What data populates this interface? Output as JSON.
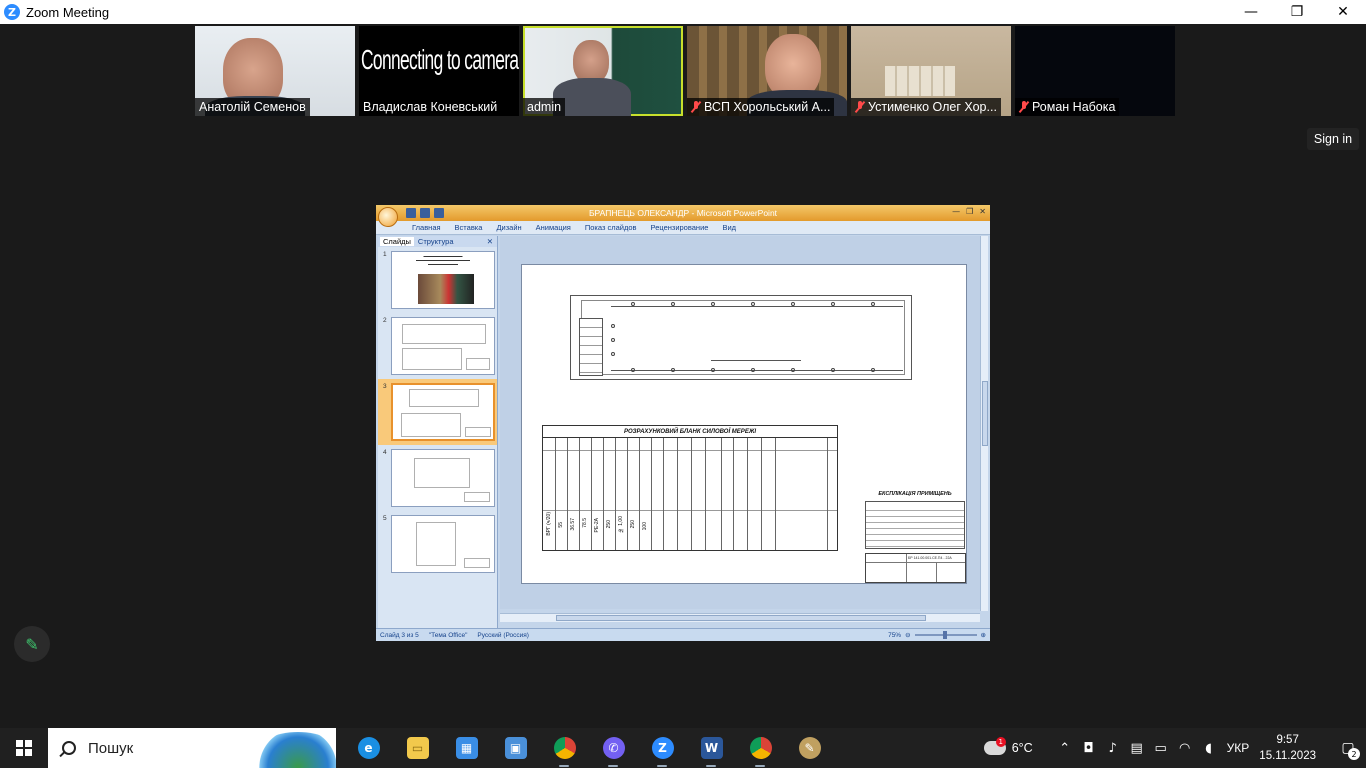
{
  "window": {
    "title": "Zoom Meeting",
    "minimize": "—",
    "maximize": "❐",
    "close": "✕"
  },
  "participants": [
    {
      "name": "Анатолій Семенов",
      "muted": false,
      "video": "face"
    },
    {
      "name": "Владислав Коневський",
      "muted": false,
      "video": "connecting",
      "overlay": "Connecting to camera..."
    },
    {
      "name": "admin",
      "muted": false,
      "video": "face",
      "active": true
    },
    {
      "name": "ВСП Хорольський А...",
      "muted": true,
      "video": "face"
    },
    {
      "name": "Устименко Олег Хор...",
      "muted": true,
      "video": "room"
    },
    {
      "name": "Роман Набока",
      "muted": true,
      "video": "off"
    }
  ],
  "signin_label": "Sign in",
  "share": {
    "doc_title": "БРАПНЕЦЬ ОЛЕКСАНДР - Microsoft PowerPoint",
    "ribbon_tabs": [
      "Главная",
      "Вставка",
      "Дизайн",
      "Анимация",
      "Показ слайдов",
      "Рецензирование",
      "Вид"
    ],
    "panel_tabs": [
      "Слайды",
      "Структура"
    ],
    "slides": [
      "1",
      "2",
      "3",
      "4",
      "5"
    ],
    "selected_slide": 3,
    "slide_content": {
      "table_title": "РОЗРАХУНКОВИЙ БЛАНК СИЛОВОЇ МЕРЕЖІ",
      "table_values": [
        "ВРГ (ч/20)",
        "55",
        "36.57",
        "78.5",
        "РЕ-2А",
        "250",
        "№ 1,00",
        "250",
        "100"
      ],
      "explication_title": "ЕКСПЛІКАЦІЯ ПРИМІЩЕНЬ",
      "stamp_code": "БР 141.00.001.СЕ.П4 - 22А"
    },
    "status": {
      "slide": "Слайд 3 из 5",
      "theme": "\"Тема Office\"",
      "lang": "Русский (Россия)",
      "zoom": "75%"
    }
  },
  "taskbar": {
    "search_placeholder": "Пошук",
    "apps": [
      {
        "name": "edge",
        "color": "#1a8fe3",
        "glyph": "e"
      },
      {
        "name": "explorer",
        "color": "#f2c94c",
        "glyph": "▭"
      },
      {
        "name": "store",
        "color": "#3a8ee6",
        "glyph": "▦"
      },
      {
        "name": "monitor",
        "color": "#4a90d9",
        "glyph": "▣"
      },
      {
        "name": "chrome",
        "color": "#db4437",
        "glyph": "◉"
      },
      {
        "name": "viber",
        "color": "#7360f2",
        "glyph": "✆"
      },
      {
        "name": "zoom",
        "color": "#2d8cff",
        "glyph": "Z"
      },
      {
        "name": "word",
        "color": "#2b579a",
        "glyph": "W"
      },
      {
        "name": "chrome-app",
        "color": "#0f9d58",
        "glyph": "◉"
      },
      {
        "name": "paint",
        "color": "#c0a060",
        "glyph": "✎"
      }
    ],
    "weather": "6°C",
    "weather_badge": "1",
    "lang": "УКР",
    "time": "9:57",
    "date": "15.11.2023",
    "notifications": "2"
  }
}
